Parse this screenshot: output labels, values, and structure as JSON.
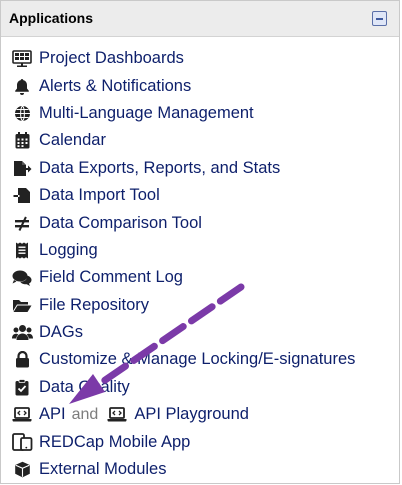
{
  "panel": {
    "title": "Applications",
    "collapse_icon": "collapse-minus-icon"
  },
  "items": [
    {
      "label": "Project Dashboards",
      "icon": "dashboard-icon"
    },
    {
      "label": "Alerts & Notifications",
      "icon": "bell-icon"
    },
    {
      "label": "Multi-Language Management",
      "icon": "globe-icon"
    },
    {
      "label": "Calendar",
      "icon": "calendar-icon"
    },
    {
      "label": "Data Exports, Reports, and Stats",
      "icon": "file-export-icon"
    },
    {
      "label": "Data Import Tool",
      "icon": "file-import-icon"
    },
    {
      "label": "Data Comparison Tool",
      "icon": "not-equal-icon"
    },
    {
      "label": "Logging",
      "icon": "receipt-icon"
    },
    {
      "label": "Field Comment Log",
      "icon": "comments-icon"
    },
    {
      "label": "File Repository",
      "icon": "folder-open-icon"
    },
    {
      "label": "DAGs",
      "icon": "users-icon"
    },
    {
      "label": "Customize & Manage Locking/E-signatures",
      "icon": "lock-icon"
    },
    {
      "label": "Data Quality",
      "icon": "clipboard-check-icon"
    },
    {
      "label": "API",
      "icon": "laptop-code-icon",
      "sep": "and",
      "label2": "API Playground",
      "icon2": "laptop-code-icon"
    },
    {
      "label": "REDCap Mobile App",
      "icon": "tablet-icon"
    },
    {
      "label": "External Modules",
      "icon": "cube-icon"
    }
  ],
  "annotation": {
    "type": "dashed-arrow",
    "color": "#7b3aa8",
    "points_to": "API"
  }
}
